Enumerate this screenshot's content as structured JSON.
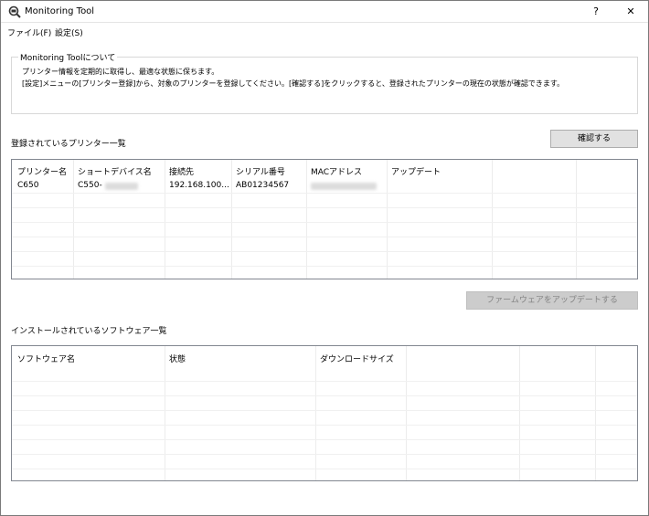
{
  "window": {
    "title": "Monitoring Tool",
    "help_label": "?",
    "close_label": "✕"
  },
  "menu": {
    "file": "ファイル(F)",
    "settings": "設定(S)"
  },
  "about": {
    "legend": "Monitoring Toolについて",
    "line1": "プリンター情報を定期的に取得し、最適な状態に保ちます。",
    "line2": "[設定]メニューの[プリンター登録]から、対象のプリンターを登録してください。[確認する]をクリックすると、登録されたプリンターの現在の状態が確認できます。"
  },
  "printers": {
    "title": "登録されているプリンター一覧",
    "confirm_button": "確認する",
    "columns": [
      "プリンター名",
      "ショートデバイス名",
      "接続先",
      "シリアル番号",
      "MACアドレス",
      "アップデート"
    ],
    "rows": [
      {
        "name": "C650",
        "short_name": "C550-",
        "connection": "192.168.100...",
        "serial": "AB01234567",
        "mac": "",
        "update": ""
      }
    ]
  },
  "firmware": {
    "update_button": "ファームウェアをアップデートする"
  },
  "software": {
    "title": "インストールされているソフトウェア一覧",
    "columns": [
      "ソフトウェア名",
      "状態",
      "ダウンロードサイズ"
    ]
  }
}
